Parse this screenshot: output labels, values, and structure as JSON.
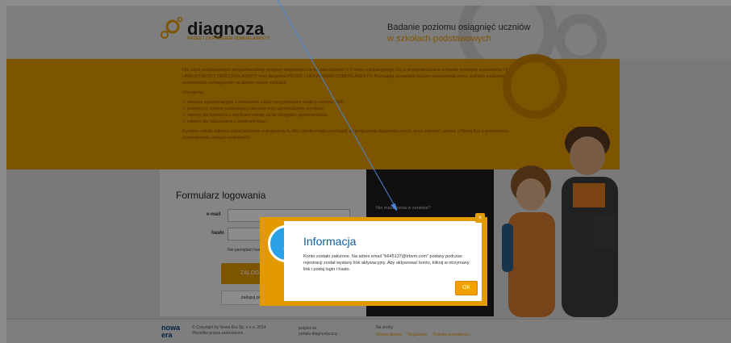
{
  "header": {
    "logo_text": "diagnoza",
    "logo_sub": "PRZED I ZA PROGIEM ODMORLASKETY",
    "tagline_line1": "Badanie poziomu osiągnięć uczniów",
    "tagline_line2": "w szkołach podstawowych"
  },
  "banner": {
    "paragraph1": "Dla szkół podstawowych przygotowaliśmy program diagnostyczne na zakończenie I i II etapu edukacyjnego. Są to przeprowadzane w formie próbnych egzaminów TEST UMIEJĘTNOŚCI TRZECIOKLASISTY oraz diagnoza PRZED I ZA PROGIEM ODMORLASKETY. Pozwalają sprawdzić poziom opanowania przez uczniów wiadomości i umiejętności wymaganych na danym etapie edukacji.",
    "offer_heading": "Oferujemy:",
    "offer_items": [
      "arkusze egzaminacyjne z zestawami zadań przygotowane według wzorów CKE,",
      "praktyczny system pozwalający arkusze przy wprowadzaniu wyników,",
      "raporty dla dyrektora z wynikami szkoły na tle osiągnięć ogólnopolskich,",
      "raporty dla nauczyciela z wynikami klasy."
    ],
    "paragraph2": "Dyrektor szkoły zgłasza udział placówki w programach. Aby szkoła mogła przystąpić do programów diagnostycznych, musi zawrzeć umowę z Nową Erą o powierzeniu przetwarzania danych osobowych."
  },
  "login_form": {
    "title": "Formularz logowania",
    "email_label": "e-mail",
    "password_label": "hasło",
    "remember_text": "Nie pamiętam hasła",
    "login_button": "ZALOGUJ",
    "alt_login_button": "zaloguj przez"
  },
  "dark_panel": {
    "question": "Nie masz konta w serwisie?"
  },
  "footer": {
    "logo_line1": "nowa",
    "logo_line2": "era",
    "copyright_line1": "© Copyright by Nowa Era Sp. z o.o. 2014",
    "copyright_line2": "Wszelkie prawa zastrzeżone.",
    "project_line1": "projekt na",
    "project_line2": "portalu diagnostyczny",
    "nav_heading": "Na skróty",
    "nav_links": [
      "Strona główna",
      "Regulamin",
      "Polityka prywatności"
    ]
  },
  "modal": {
    "icon": "info-icon",
    "title": "Informacja",
    "body": "Konto zostało założone. Na adres email \"b645137@trbvm.com\" podany podczas rejestracji został wysłany link aktywacyjny. Aby aktywować konto, kliknij w otrzymany link i podaj login i hasło.",
    "ok_label": "OK",
    "close_label": "×"
  },
  "colors": {
    "accent": "#e39a00",
    "info_blue": "#2aa0e6",
    "title_blue": "#0d5ca3"
  }
}
